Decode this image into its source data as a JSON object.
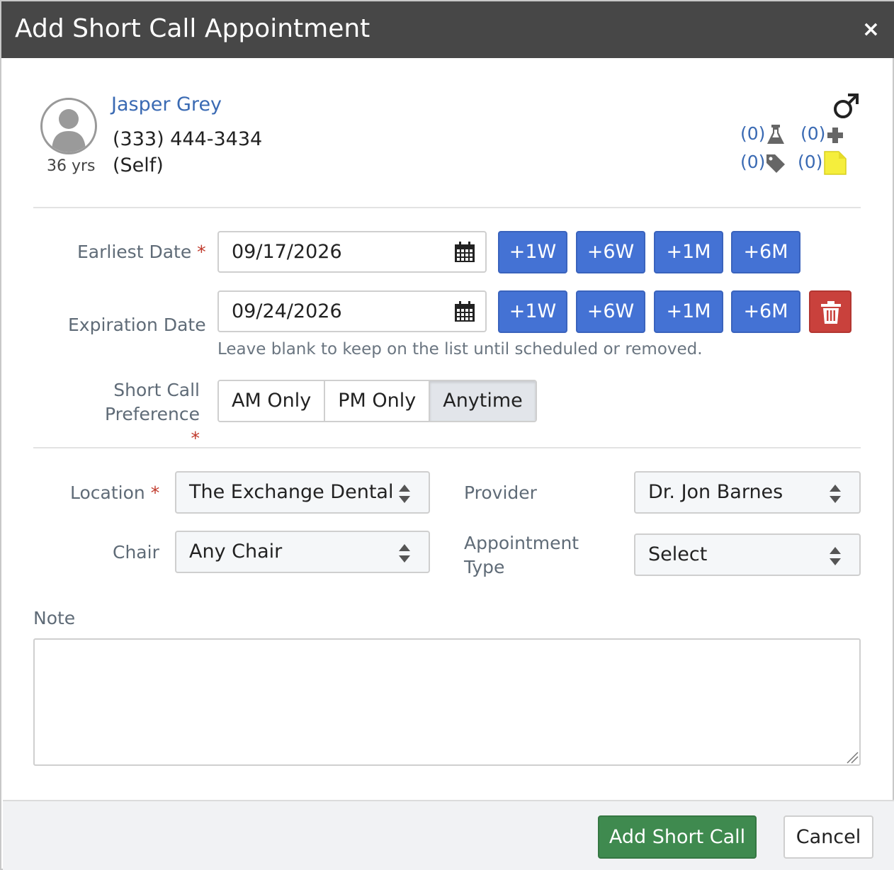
{
  "dialog": {
    "title": "Add Short Call Appointment",
    "close_symbol": "×"
  },
  "patient": {
    "name": "Jasper Grey",
    "phone": "(333) 444-3434",
    "relation": "(Self)",
    "age": "36 yrs",
    "gender_icon": "male-symbol-icon",
    "counters": {
      "lab": "(0)",
      "medical": "(0)",
      "tags": "(0)",
      "notes": "(0)"
    }
  },
  "form": {
    "earliest_date": {
      "label": "Earliest Date",
      "required_mark": "*",
      "value": "09/17/2026"
    },
    "expiration_date": {
      "label": "Expiration Date",
      "value": "09/24/2026",
      "help": "Leave blank to keep on the list until scheduled or removed."
    },
    "quick_buttons": [
      "+1W",
      "+6W",
      "+1M",
      "+6M"
    ],
    "preference": {
      "label_line1": "Short Call",
      "label_line2": "Preference",
      "required_mark": "*",
      "options": [
        "AM Only",
        "PM Only",
        "Anytime"
      ],
      "selected": "Anytime"
    },
    "location": {
      "label": "Location",
      "required_mark": "*",
      "value": "The Exchange Dental"
    },
    "chair": {
      "label": "Chair",
      "value": "Any Chair"
    },
    "provider": {
      "label": "Provider",
      "value": "Dr. Jon Barnes"
    },
    "appointment_type": {
      "label_line1": "Appointment",
      "label_line2": "Type",
      "value": "Select"
    },
    "note": {
      "label": "Note",
      "value": ""
    }
  },
  "footer": {
    "submit_label": "Add Short Call",
    "cancel_label": "Cancel"
  },
  "colors": {
    "titlebar": "#474747",
    "primary_blue": "#4472d4",
    "danger_red": "#c9413c",
    "success_green": "#3f8a4f",
    "link_blue": "#3a6ab3",
    "note_yellow": "#f5ee3c"
  }
}
